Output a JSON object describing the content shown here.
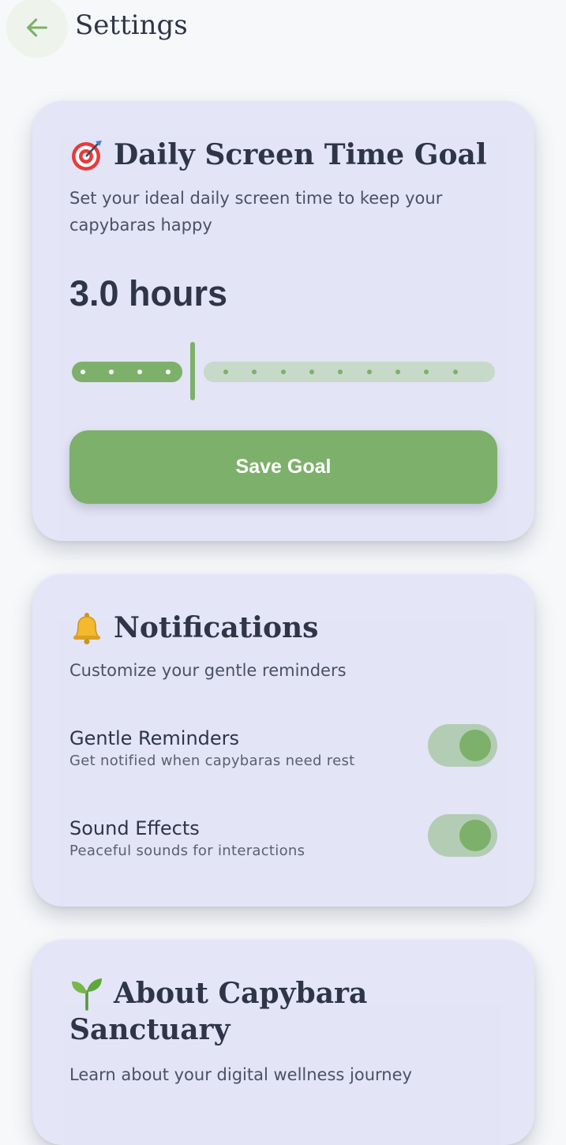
{
  "header": {
    "title": "Settings",
    "back_icon": "arrow-left-icon"
  },
  "colors": {
    "accent": "#7db06a",
    "card_bg": "#e4e5f7",
    "page_bg": "#f6f8fa",
    "text": "#2e3547",
    "toggle_track": "#b3cdb4",
    "slider_inactive": "#c7d9c8"
  },
  "goal": {
    "icon": "target-icon",
    "title": "Daily Screen Time Goal",
    "subtitle_line1": "Set your ideal daily screen time to keep your",
    "subtitle_line2": "capybaras happy",
    "value": "3.0 hours",
    "slider_fraction": 0.28,
    "save_label": "Save Goal"
  },
  "notifications": {
    "icon": "bell-icon",
    "title": "Notifications",
    "subtitle": "Customize your gentle reminders",
    "items": [
      {
        "label": "Gentle Reminders",
        "description": "Get notified when capybaras need rest",
        "enabled": true
      },
      {
        "label": "Sound Effects",
        "description": "Peaceful sounds for interactions",
        "enabled": true
      }
    ]
  },
  "about": {
    "icon": "seedling-icon",
    "title_line1": "About Capybara",
    "title_line2": "Sanctuary",
    "subtitle": "Learn about your digital wellness journey"
  }
}
